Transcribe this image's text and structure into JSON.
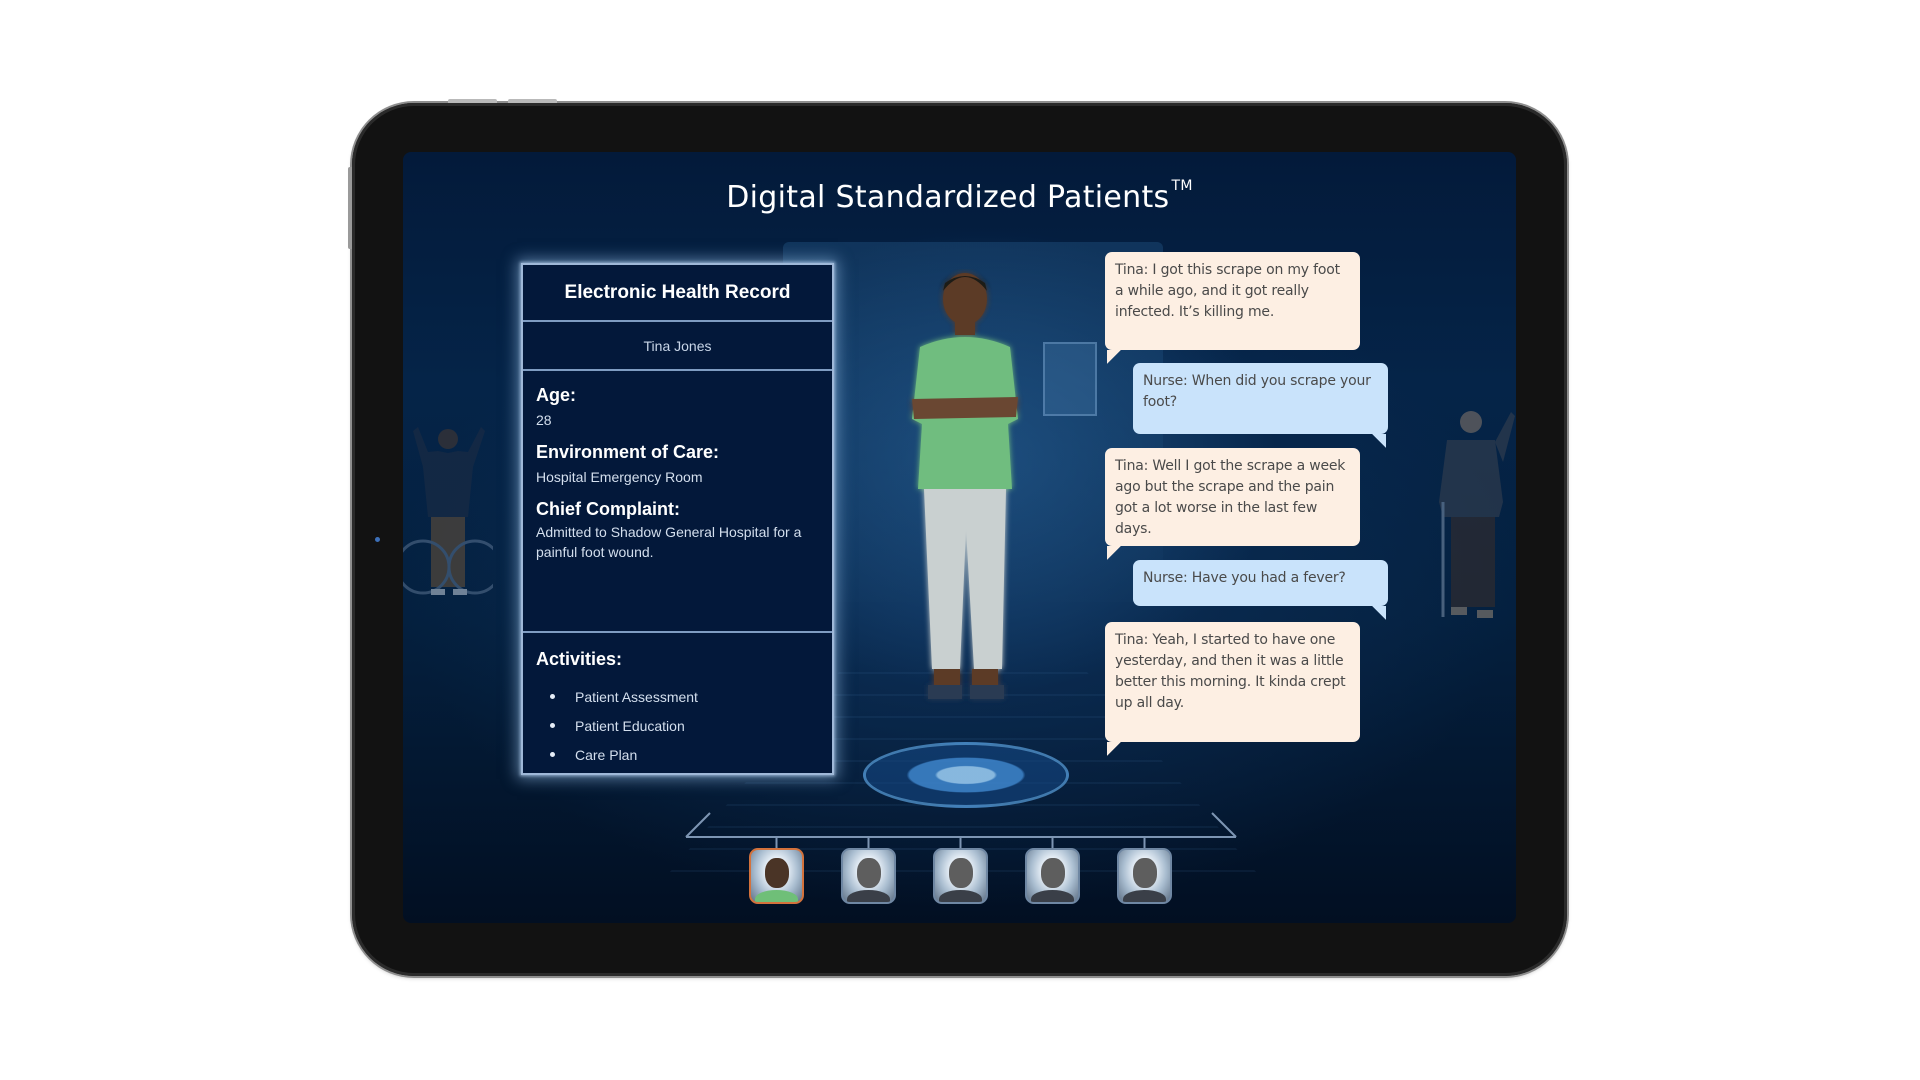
{
  "app": {
    "title": "Digital Standardized Patients",
    "trademark": "TM"
  },
  "ehr": {
    "header": "Electronic Health Record",
    "patient_name": "Tina Jones",
    "fields": [
      {
        "label": "Age:",
        "value": "28"
      },
      {
        "label": "Environment of Care:",
        "value": "Hospital Emergency Room"
      },
      {
        "label": "Chief Complaint:",
        "value": "Admitted to Shadow General Hospital for a painful foot wound."
      }
    ],
    "activities_label": "Activities:",
    "activities": [
      "Patient Assessment",
      "Patient Education",
      "Care Plan"
    ]
  },
  "conversation": [
    {
      "speaker": "tina",
      "text": "Tina: I got this scrape on my foot a while ago, and it got really infected. It’s killing me."
    },
    {
      "speaker": "nurse",
      "text": "Nurse: When did you scrape your foot?"
    },
    {
      "speaker": "tina",
      "text": "Tina: Well I got the scrape a week ago but the scrape and the pain got a lot worse in the last few days."
    },
    {
      "speaker": "nurse",
      "text": "Nurse: Have you had a fever?"
    },
    {
      "speaker": "tina",
      "text": "Tina: Yeah, I started to have one yesterday, and then it was a little better this morning. It kinda crept up all day."
    }
  ],
  "patient_selector": {
    "patients": [
      {
        "id": "tina-jones",
        "selected": true
      },
      {
        "id": "patient-2",
        "selected": false
      },
      {
        "id": "patient-3",
        "selected": false
      },
      {
        "id": "patient-4",
        "selected": false
      },
      {
        "id": "patient-5",
        "selected": false
      }
    ],
    "selected_color": "#d3723c"
  },
  "colors": {
    "tina_bubble": "#fdefe3",
    "nurse_bubble": "#c9e3fb",
    "panel_bg": "#03183a",
    "panel_border": "#9fb8d8"
  }
}
